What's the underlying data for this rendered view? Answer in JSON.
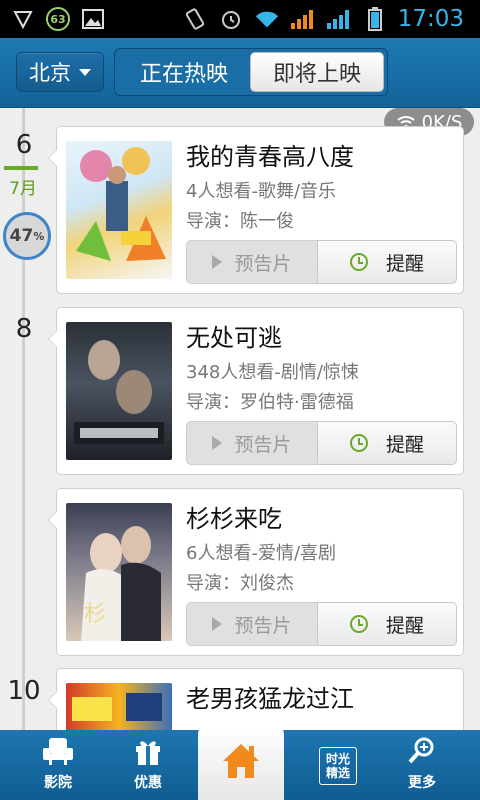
{
  "status_bar": {
    "badge": "63",
    "time": "17:03",
    "icons": [
      "shield-icon",
      "cpu-badge-icon",
      "image-icon",
      "vibrate-icon",
      "alarm-icon",
      "wifi-icon",
      "signal-icon",
      "signal-icon",
      "battery-icon"
    ]
  },
  "header": {
    "city": "北京",
    "tabs": [
      "正在热映",
      "即将上映"
    ],
    "active_tab": 0
  },
  "network": {
    "speed": "0K/S"
  },
  "timeline": {
    "progress": "47",
    "progress_unit": "%",
    "month": "7月",
    "dates": [
      "6",
      "8",
      "10"
    ]
  },
  "movies": [
    {
      "title": "我的青春高八度",
      "meta": "4人想看-歌舞/音乐",
      "director": "导演：陈一俊",
      "trailer_label": "预告片",
      "remind_label": "提醒"
    },
    {
      "title": "无处可逃",
      "meta": "348人想看-剧情/惊悚",
      "director": "导演：罗伯特·雷德福",
      "trailer_label": "预告片",
      "remind_label": "提醒"
    },
    {
      "title": "杉杉来吃",
      "meta": "6人想看-爱情/喜剧",
      "director": "导演：刘俊杰",
      "trailer_label": "预告片",
      "remind_label": "提醒"
    },
    {
      "title": "老男孩猛龙过江"
    }
  ],
  "tabbar": {
    "items": [
      {
        "label": "影院",
        "icon": "armchair-icon"
      },
      {
        "label": "优惠",
        "icon": "gift-icon"
      },
      {
        "label": "",
        "icon": "home-icon"
      },
      {
        "label": "",
        "icon": "time-select-icon",
        "box_line1": "时光",
        "box_line2": "精选"
      },
      {
        "label": "更多",
        "icon": "search-more-icon"
      }
    ]
  }
}
